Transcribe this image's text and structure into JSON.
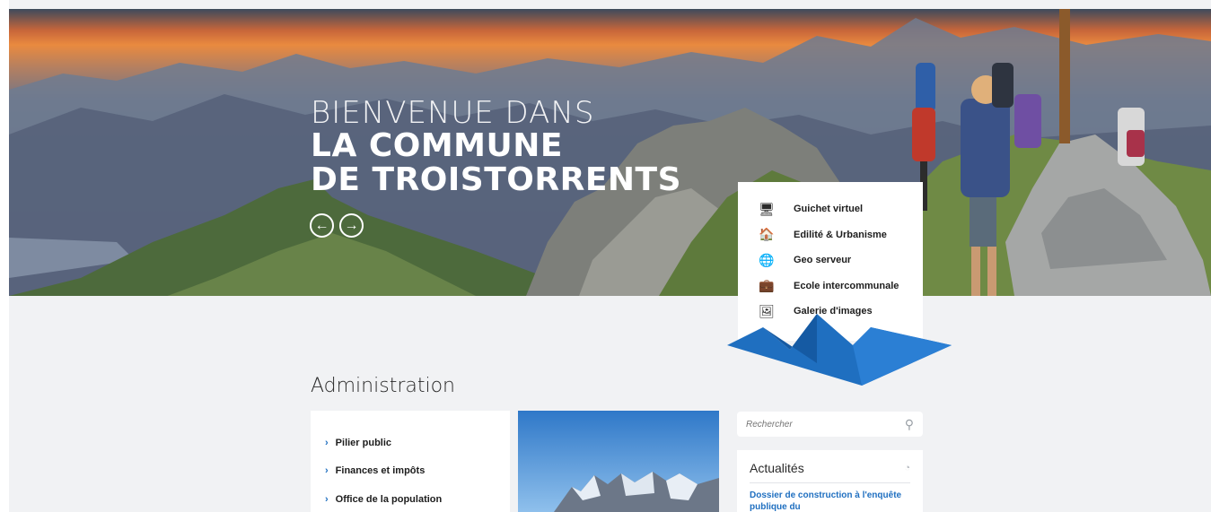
{
  "hero": {
    "line1": "BIENVENUE DANS",
    "line2": "LA COMMUNE",
    "line3": "DE TROISTORRENTS",
    "prev_icon": "arrow-left-circle-icon",
    "next_icon": "arrow-right-circle-icon",
    "prev_glyph": "←",
    "next_glyph": "→"
  },
  "quick_links": [
    {
      "label": "Guichet virtuel",
      "icon": "monitor-icon",
      "glyph": "🖥"
    },
    {
      "label": "Edilité & Urbanisme",
      "icon": "house-icon",
      "glyph": "🏠"
    },
    {
      "label": "Geo serveur",
      "icon": "globe-icon",
      "glyph": "🌐"
    },
    {
      "label": "Ecole intercommunale",
      "icon": "briefcase-icon",
      "glyph": "💼"
    },
    {
      "label": "Galerie d'images",
      "icon": "image-icon",
      "glyph": "🖼"
    }
  ],
  "administration": {
    "title": "Administration",
    "items": [
      {
        "label": "Pilier public"
      },
      {
        "label": "Finances et impôts"
      },
      {
        "label": "Office de la population"
      }
    ],
    "chevron": "›"
  },
  "search": {
    "placeholder": "Rechercher",
    "icon": "search-icon",
    "glyph": "⚲"
  },
  "news": {
    "title": "Actualités",
    "rss_icon": "rss-icon",
    "rss_glyph": "◔",
    "first_item": "Dossier de construction à l'enquête publique du"
  },
  "colors": {
    "accent": "#1f6fc0",
    "accent_dark": "#155aa3",
    "background": "#f1f2f4"
  }
}
